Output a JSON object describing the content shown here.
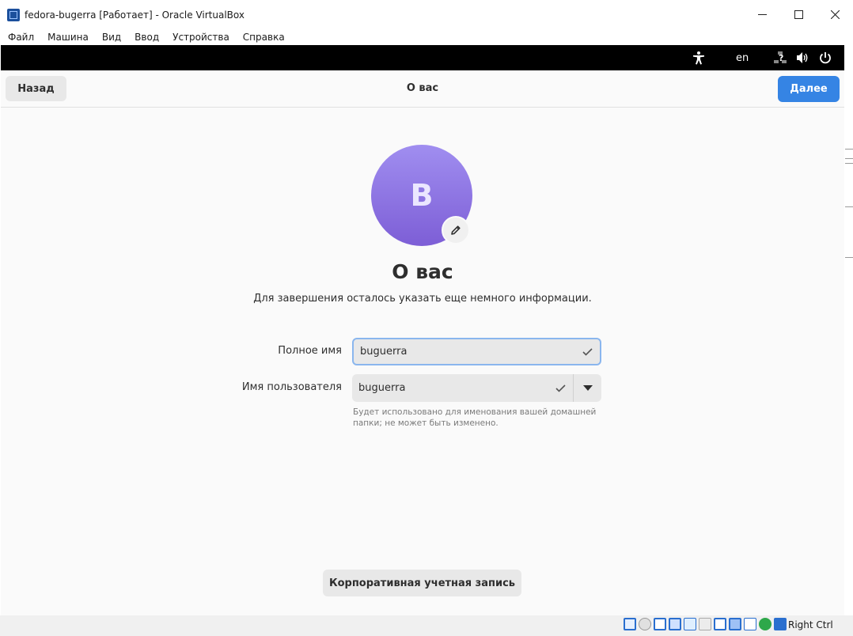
{
  "window": {
    "title": "fedora-bugerra [Работает] - Oracle VirtualBox",
    "minimize_icon": "minimize-icon",
    "maximize_icon": "maximize-icon",
    "close_icon": "close-icon"
  },
  "menu": {
    "items": [
      "Файл",
      "Машина",
      "Вид",
      "Ввод",
      "Устройства",
      "Справка"
    ]
  },
  "gnome_topbar": {
    "language": "en",
    "icons": [
      "accessibility-icon",
      "network-unknown-icon",
      "volume-icon",
      "power-icon"
    ]
  },
  "header": {
    "back_label": "Назад",
    "title": "О вас",
    "next_label": "Далее"
  },
  "colors": {
    "accent": "#3584e4",
    "avatar_top": "#a08ef0",
    "avatar_bottom": "#7d5ed6"
  },
  "avatar": {
    "letter": "B",
    "edit_icon": "pencil-icon"
  },
  "page": {
    "heading": "О вас",
    "subtitle": "Для завершения осталось указать еще немного информации."
  },
  "form": {
    "fullname_label": "Полное имя",
    "fullname_value": "buguerra",
    "username_label": "Имя пользователя",
    "username_value": "buguerra",
    "username_hint": "Будет использовано для именования вашей домашней папки; не может быть изменено."
  },
  "enterprise_button": "Корпоративная учетная запись",
  "statusbar": {
    "host_key": "Right Ctrl"
  }
}
